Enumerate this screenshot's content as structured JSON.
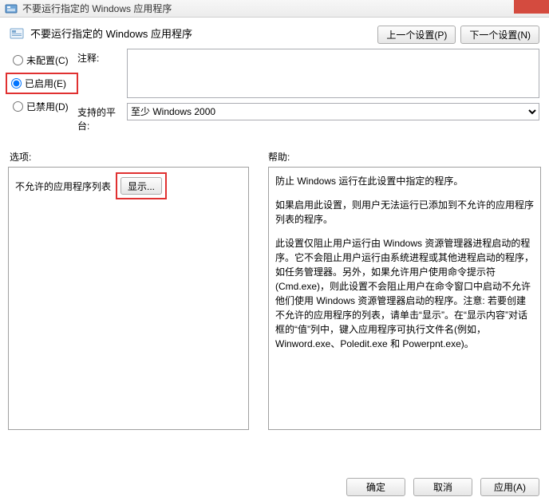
{
  "window": {
    "title": "不要运行指定的 Windows 应用程序"
  },
  "header": {
    "title": "不要运行指定的 Windows 应用程序",
    "prev_btn": "上一个设置(P)",
    "next_btn": "下一个设置(N)"
  },
  "config": {
    "radio_unconfigured": "未配置(C)",
    "radio_enabled": "已启用(E)",
    "radio_disabled": "已禁用(D)",
    "selected": "enabled",
    "comment_label": "注释:",
    "comment_value": "",
    "platform_label": "支持的平台:",
    "platform_value": "至少 Windows 2000"
  },
  "labels": {
    "options": "选项:",
    "help": "帮助:"
  },
  "options_panel": {
    "list_label": "不允许的应用程序列表",
    "show_btn": "显示..."
  },
  "help_panel": {
    "p1": "防止 Windows 运行在此设置中指定的程序。",
    "p2": "如果启用此设置，则用户无法运行已添加到不允许的应用程序列表的程序。",
    "p3": "此设置仅阻止用户运行由 Windows 资源管理器进程启动的程序。它不会阻止用户运行由系统进程或其他进程启动的程序，如任务管理器。另外，如果允许用户使用命令提示符(Cmd.exe)，则此设置不会阻止用户在命令窗口中启动不允许他们使用 Windows 资源管理器启动的程序。注意: 若要创建不允许的应用程序的列表，请单击“显示”。在“显示内容”对话框的“值”列中，键入应用程序可执行文件名(例如，Winword.exe、Poledit.exe 和 Powerpnt.exe)。"
  },
  "bottom": {
    "ok": "确定",
    "cancel": "取消",
    "apply": "应用(A)"
  }
}
